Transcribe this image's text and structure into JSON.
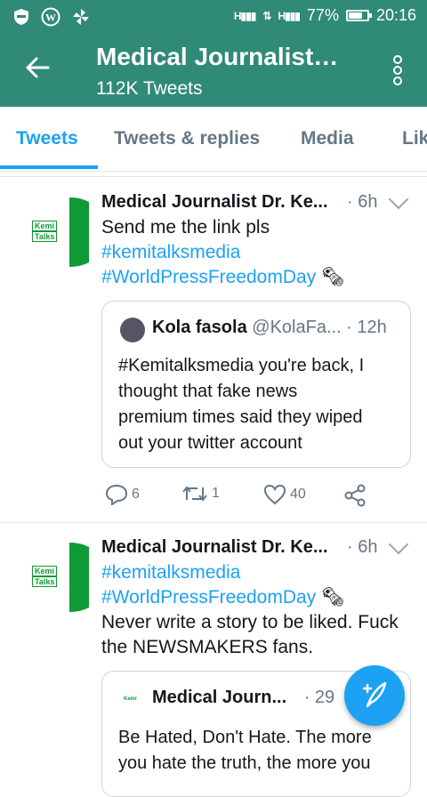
{
  "status_bar": {
    "battery_percent": "77%",
    "time": "20:16",
    "icons": [
      "shield-icon",
      "wordpress-icon",
      "pinwheel-icon",
      "signal-icon",
      "data-arrows-icon",
      "signal-icon",
      "battery-icon"
    ]
  },
  "app_bar": {
    "title": "Medical Journalist…",
    "subtitle": "112K Tweets",
    "background_color": "#2f8a77"
  },
  "tabs": [
    {
      "label": "Tweets",
      "active": true
    },
    {
      "label": "Tweets & replies",
      "active": false
    },
    {
      "label": "Media",
      "active": false
    },
    {
      "label": "Lik",
      "active": false
    }
  ],
  "tweets": [
    {
      "author": "Medical Journalist Dr. Ke...",
      "time": "· 6h",
      "lines": [
        "Send me the link pls",
        "#kemitalksmedia",
        "#WorldPressFreedomDay"
      ],
      "avatar_text": [
        "Kemi",
        "Talks"
      ],
      "quote": {
        "name": "Kola fasola",
        "handle": "@KolaFa...",
        "time": "· 12h",
        "text": [
          "#Kemitalksmedia you're back, I",
          "thought that fake news",
          "premium times said they wiped",
          "out your twitter account"
        ]
      },
      "actions": {
        "replies": "6",
        "retweets": "1",
        "likes": "40"
      }
    },
    {
      "author": "Medical Journalist Dr. Ke...",
      "time": "· 6h",
      "lines": [
        "#kemitalksmedia",
        "#WorldPressFreedomDay",
        "Never write a story to be liked. Fuck",
        "the NEWSMAKERS fans."
      ],
      "avatar_text": [
        "Kemi",
        "Talks"
      ],
      "quote": {
        "name": "Medical Journ...",
        "time": "· 29",
        "text": [
          "Be Hated, Don't Hate. The more",
          "you hate the truth, the more you"
        ]
      }
    }
  ],
  "accent_color": "#1da1f2"
}
